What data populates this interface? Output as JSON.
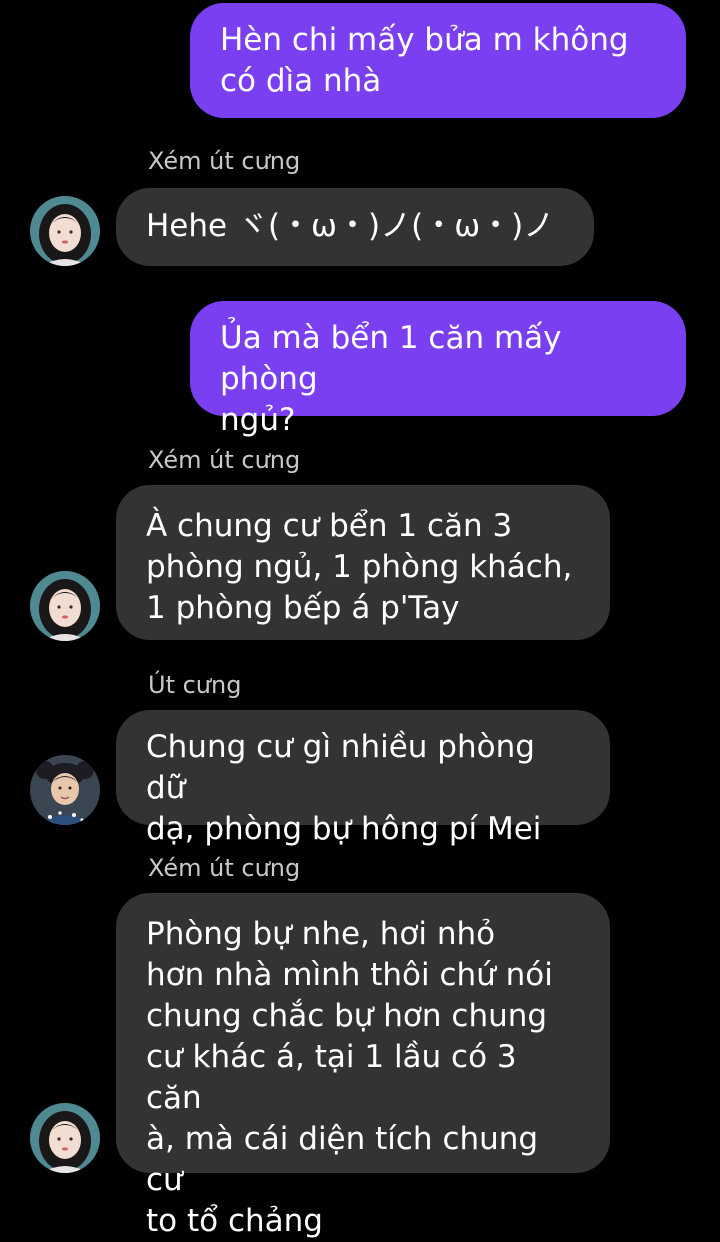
{
  "messages": [
    {
      "direction": "out",
      "text": "Hèn chi mấy bửa m không\ncó dìa nhà"
    },
    {
      "direction": "in",
      "sender": "Xém út cưng",
      "text": "Hehe ヾ(・ω・)ノ(・ω・)ノ"
    },
    {
      "direction": "out",
      "text": "Ủa mà bển 1 căn mấy phòng\nngủ?"
    },
    {
      "direction": "in",
      "sender": "Xém út cưng",
      "text": "À chung cư bển 1 căn 3\nphòng ngủ, 1 phòng khách,\n1 phòng bếp á p'Tay"
    },
    {
      "direction": "in",
      "sender": "Út cưng",
      "text": "Chung cư gì nhiều phòng dữ\ndạ, phòng bự hông pí Mei"
    },
    {
      "direction": "in",
      "sender": "Xém út cưng",
      "text": "Phòng bự nhe, hơi nhỏ\nhơn nhà mình thôi chứ nói\nchung chắc bự hơn chung\ncư khác á, tại 1 lầu có 3 căn\nà, mà cái diện tích chung cư\nto tổ chảng"
    }
  ],
  "colors": {
    "background": "#000000",
    "outgoing_bubble": "#7b3ff2",
    "incoming_bubble": "#333333",
    "sender_name": "#c8c8c8"
  },
  "icons": {
    "avatar_girl": "avatar-girl-icon",
    "avatar_boy": "avatar-boy-icon"
  }
}
